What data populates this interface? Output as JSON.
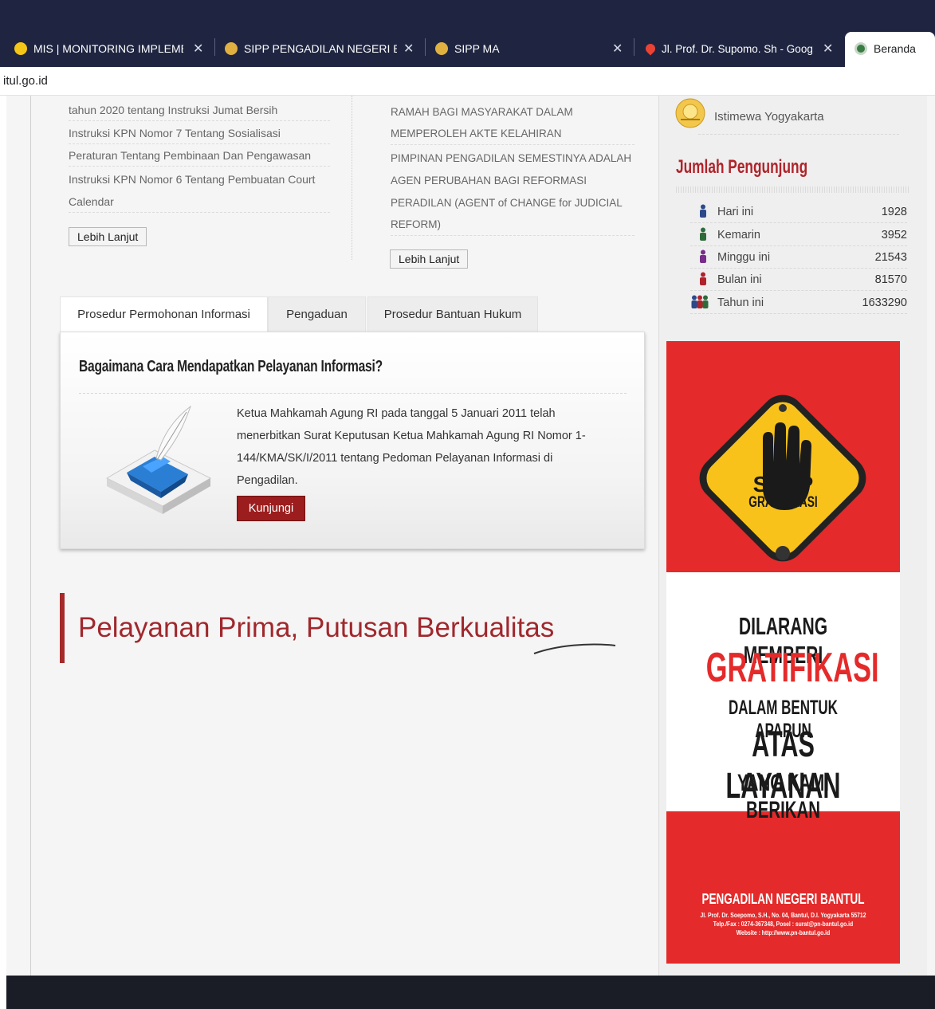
{
  "browser": {
    "tabs": [
      {
        "title": "MIS | MONITORING IMPLEMEN",
        "icon": "sun-icon",
        "color": "#f5c518"
      },
      {
        "title": "SIPP PENGADILAN NEGERI BAN",
        "icon": "court-emblem-icon",
        "color": "#e0b040"
      },
      {
        "title": "SIPP MA",
        "icon": "court-emblem-icon",
        "color": "#e0b040"
      },
      {
        "title": "Jl. Prof. Dr. Supomo. Sh - Goog",
        "icon": "map-pin-icon",
        "color": "#ea4335"
      },
      {
        "title": "Beranda",
        "icon": "court-emblem-icon",
        "color": "#3a7d44"
      }
    ],
    "close_glyph": "✕",
    "url": "itul.go.id"
  },
  "news_left": {
    "items": [
      "tahun 2020 tentang Instruksi Jumat Bersih",
      "Instruksi KPN Nomor 7 Tentang Sosialisasi",
      "Peraturan Tentang Pembinaan Dan Pengawasan",
      "Instruksi KPN Nomor 6 Tentang Pembuatan Court",
      "Calendar"
    ],
    "more_label": "Lebih Lanjut"
  },
  "news_right": {
    "items": [
      "RAMAH BAGI MASYARAKAT DALAM",
      "MEMPEROLEH AKTE KELAHIRAN",
      "PIMPINAN PENGADILAN SEMESTINYA ADALAH",
      "AGEN PERUBAHAN BAGI REFORMASI",
      "PERADILAN (AGENT of CHANGE for JUDICIAL",
      "REFORM)"
    ],
    "more_label": "Lebih Lanjut"
  },
  "service_tabs": [
    "Prosedur Permohonan Informasi",
    "Pengaduan",
    "Prosedur Bantuan Hukum"
  ],
  "panel": {
    "title": "Bagaimana Cara Mendapatkan Pelayanan Informasi?",
    "body": "Ketua Mahkamah Agung RI pada tanggal 5 Januari 2011 telah menerbitkan Surat Keputusan Ketua Mahkamah Agung RI Nomor 1-144/KMA/SK/I/2011 tentang Pedoman Pelayanan Informasi di Pengadilan.",
    "button": "Kunjungi"
  },
  "slogan": "Pelayanan Prima, Putusan Berkualitas",
  "sidebar": {
    "partner_name": "Istimewa Yogyakarta",
    "visitors_title": "Jumlah Pengunjung",
    "visitors": [
      {
        "label": "Hari ini",
        "value": "1928",
        "color": "#2c4a8a"
      },
      {
        "label": "Kemarin",
        "value": "3952",
        "color": "#2f6b3a"
      },
      {
        "label": "Minggu ini",
        "value": "21543",
        "color": "#7a2c8a"
      },
      {
        "label": "Bulan ini",
        "value": "81570",
        "color": "#b0232a"
      },
      {
        "label": "Tahun ini",
        "value": "1633290",
        "color": "#444444"
      }
    ]
  },
  "banner": {
    "stop": "STOP",
    "gratifikasi_small": "GRATIFIKASI",
    "line1": "DILARANG MEMBERI",
    "line2": "GRATIFIKASI",
    "line3": "DALAM BENTUK APAPUN",
    "line4": "ATAS LAYANAN",
    "line5": "YANG KAMI BERIKAN",
    "org": "PENGADILAN NEGERI BANTUL",
    "address": "Jl. Prof. Dr. Soepomo, S.H., No. 04, Bantul, D.I. Yogyakarta 55712",
    "contact": "Telp./Fax : 0274-367348, Posel : surat@pn-bantul.go.id",
    "website": "Website : http://www.pn-bantul.go.id"
  }
}
